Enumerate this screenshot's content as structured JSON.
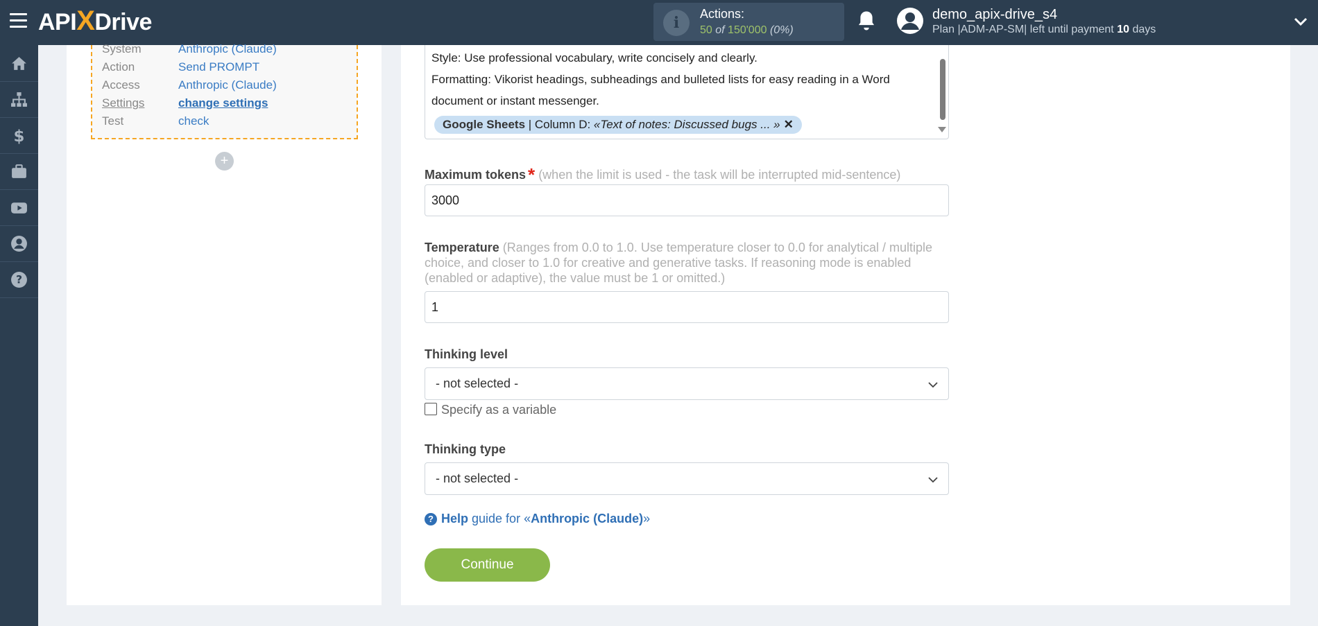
{
  "header": {
    "logo": {
      "left": "API",
      "x": "X",
      "right": "Drive"
    },
    "actions": {
      "label": "Actions:",
      "used": "50",
      "of": "of",
      "total": "150'000",
      "percent": "(0%)"
    },
    "user": {
      "name": "demo_apix-drive_s4",
      "plan_prefix": "Plan |ADM-AP-SM| left until payment",
      "days_num": "10",
      "days_word": "days"
    }
  },
  "sidebar": {
    "items": [
      "home-icon",
      "sitemap-icon",
      "dollar-icon",
      "briefcase-icon",
      "youtube-icon",
      "user-icon",
      "help-icon"
    ]
  },
  "step": {
    "rows": [
      {
        "key": "System",
        "value": "Anthropic (Claude)"
      },
      {
        "key": "Action",
        "value": "Send PROMPT"
      },
      {
        "key": "Access",
        "value": "Anthropic (Claude)"
      },
      {
        "key": "Settings",
        "value": "change settings"
      },
      {
        "key": "Test",
        "value": "check"
      }
    ],
    "add_symbol": "+"
  },
  "prompt": {
    "line1": "Style: Use professional vocabulary, write concisely and clearly.",
    "line2": "Formatting: Vikorist headings, subheadings and bulleted lists for easy reading in a Word",
    "line3": "document or instant messenger.",
    "chip": {
      "source": "Google Sheets",
      "column": " | Column D: ",
      "value": "«Text of notes: Discussed bugs ... »",
      "remove": "✕"
    }
  },
  "max_tokens": {
    "label": "Maximum tokens",
    "required": "*",
    "hint": "(when the limit is used - the task will be interrupted mid-sentence)",
    "value": "3000"
  },
  "temperature": {
    "label": "Temperature",
    "hint": "(Ranges from 0.0 to 1.0. Use temperature closer to 0.0 for analytical / multiple choice, and closer to 1.0 for creative and generative tasks. If reasoning mode is enabled (enabled or adaptive), the value must be 1 or omitted.)",
    "value": "1"
  },
  "thinking_level": {
    "label": "Thinking level",
    "selected": "- not selected -",
    "checkbox_label": "Specify as a variable"
  },
  "thinking_type": {
    "label": "Thinking type",
    "selected": "- not selected -"
  },
  "help": {
    "prefix": "Help",
    "middle": " guide for «",
    "name": "Anthropic (Claude)",
    "suffix": "»"
  },
  "continue_label": "Continue"
}
